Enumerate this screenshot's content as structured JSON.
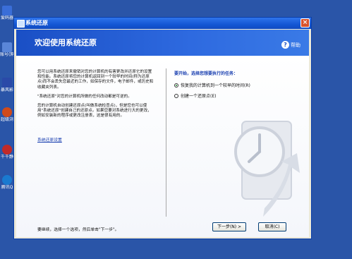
{
  "desktop": {
    "icons": [
      {
        "label": "爱码器",
        "color": "#3a6ed8"
      },
      {
        "label": "账号(网",
        "color": "#5a86d8"
      },
      {
        "label": "暴风影",
        "color": "#2a4aa8"
      },
      {
        "label": "超级浏",
        "color": "#d04a1a"
      },
      {
        "label": "千千静",
        "color": "#c02a2a"
      },
      {
        "label": "腾讯Q",
        "color": "#1a7ad0"
      }
    ]
  },
  "window": {
    "title": "系统还原",
    "close_label": "×",
    "header_title": "欢迎使用系统还原",
    "help_label": "帮助",
    "intro_paragraphs": [
      "您可以用系统还原来撤销对您的计算机的有害更改并还原它的设置和性能。系统还原将您的计算机返回到一个较早的时间(称为还原点)而不会丢失您最近的工作，如保存的文件，电子邮件，或历史和收藏夹列表。",
      "\"系统还原\"对您的计算机所做的任何改动都是可逆的。",
      "您的计算机自动创建还原点(叫做系统检查点)，但是您也可以使用\"系统还原\"创建自己的还原点。如果您要对系统进行大的更改，例如安装新的程序或更改注册表，这是很有用的。"
    ],
    "settings_link": "系统还原设置",
    "task_prompt": "要开始，选择您想要执行的任务：",
    "options": [
      {
        "label": "恢复我的计算机到一个较早的时间(R)",
        "selected": true
      },
      {
        "label": "创建一个还原点(E)",
        "selected": false
      }
    ],
    "footer_text": "要继续，选择一个选项，然后单击\"下一步\"。",
    "next_button": "下一步(N) >",
    "cancel_button": "取消(C)"
  },
  "colors": {
    "desktop_bg": "#2a55a8",
    "title_bar": "#1457d4",
    "header_bg": "#1a4fc5",
    "link": "#1a3fb0"
  }
}
